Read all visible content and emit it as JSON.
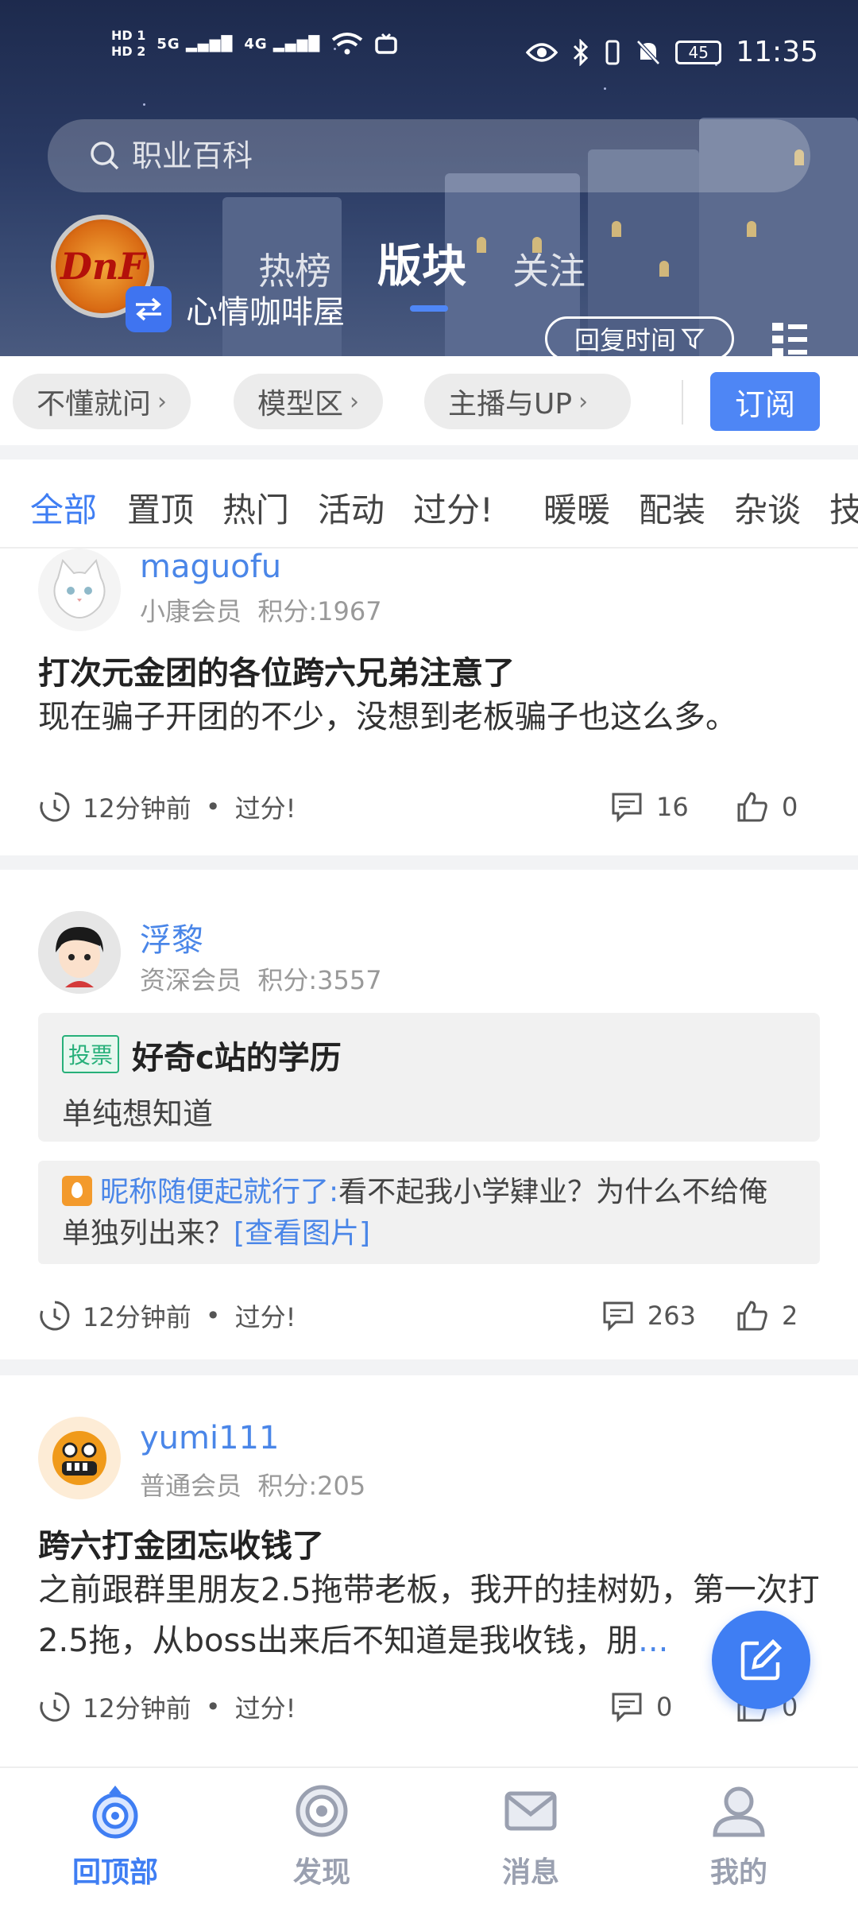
{
  "status_bar": {
    "time": "11:35",
    "battery": "45",
    "sim1": "HD 1",
    "sim2": "HD 2",
    "net1": "5G",
    "net2": "4G"
  },
  "search": {
    "placeholder": "职业百科"
  },
  "header": {
    "tabs": [
      "热榜",
      "版块",
      "关注"
    ],
    "active_tab_index": 1,
    "forum_name": "心情咖啡屋",
    "sort_label": "回复时间",
    "logo_text": "DnF"
  },
  "quick_links": {
    "items": [
      "不懂就问",
      "模型区",
      "主播与UP"
    ],
    "subscribe_label": "订阅"
  },
  "categories": {
    "items": [
      "全部",
      "置顶",
      "热门",
      "活动",
      "过分!",
      "暖暖",
      "配装",
      "杂谈",
      "技"
    ],
    "active_index": 0
  },
  "posts": [
    {
      "username": "maguofu",
      "level": "小康会员",
      "points": "积分:1967",
      "title": "打次元金团的各位跨六兄弟注意了",
      "body": "现在骗子开团的不少，没想到老板骗子也这么多。",
      "time": "12分钟前",
      "category": "过分!",
      "comments": "16",
      "likes": "0"
    },
    {
      "username": "浮黎",
      "level": "资深会员",
      "points": "积分:3557",
      "vote_badge": "投票",
      "vote_title": "好奇c站的学历",
      "vote_desc": "单纯想知道",
      "reply_nick": "昵称随便起就行了:",
      "reply_text": "看不起我小学肄业？为什么不给俺单独列出来？",
      "reply_link": "[查看图片]",
      "time": "12分钟前",
      "category": "过分!",
      "comments": "263",
      "likes": "2"
    },
    {
      "username": "yumi111",
      "level": "普通会员",
      "points": "积分:205",
      "title": "跨六打金团忘收钱了",
      "body": "之前跟群里朋友2.5拖带老板，我开的挂树奶，第一次打2.5拖，从boss出来后不知道是我收钱，朋",
      "ellipsis": "...",
      "time": "12分钟前",
      "category": "过分!",
      "comments": "0",
      "likes": "0"
    }
  ],
  "bottom_nav": {
    "items": [
      "回顶部",
      "发现",
      "消息",
      "我的"
    ],
    "active_index": 0
  },
  "colors": {
    "accent": "#3f7ef3",
    "username": "#4a86e8",
    "vote_badge": "#27b07a",
    "fire": "#f39a2c"
  }
}
